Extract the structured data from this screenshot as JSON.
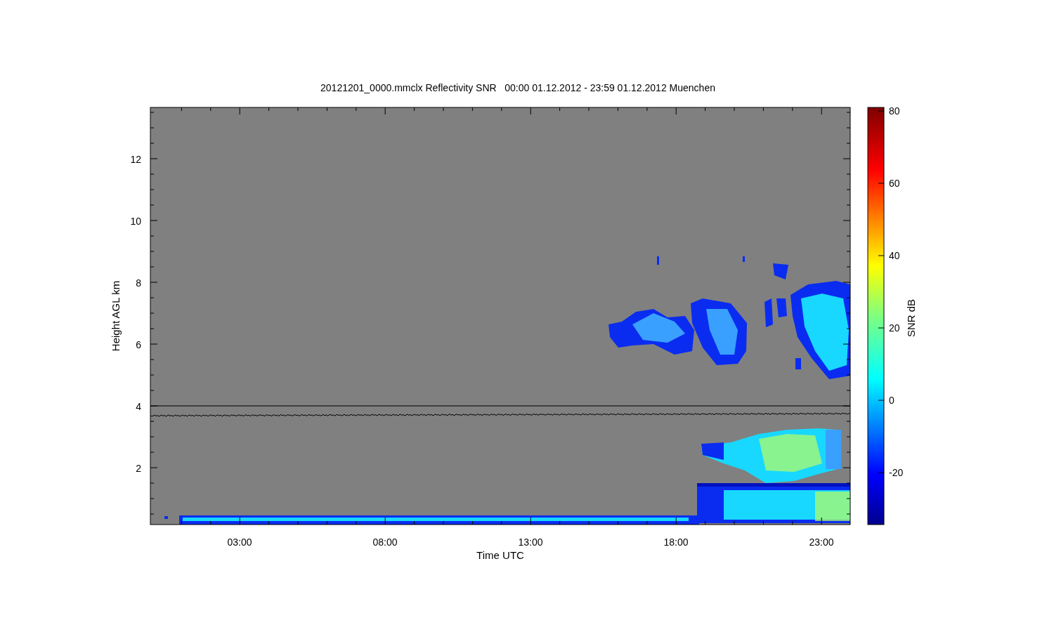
{
  "figure": {
    "title": "20121201_0000.mmclx Reflectivity SNR   00:00 01.12.2012 - 23:59 01.12.2012 Muenchen",
    "x_axis": {
      "label": "Time UTC",
      "ticks": [
        "03:00",
        "08:00",
        "13:00",
        "18:00",
        "23:00"
      ]
    },
    "y_axis": {
      "label": "Height AGL km",
      "ticks": [
        "12",
        "10",
        "8",
        "6",
        "4",
        "2"
      ]
    },
    "colorbar": {
      "label": "SNR dB",
      "ticks": [
        "80",
        "60",
        "40",
        "20",
        "0",
        "-20"
      ]
    }
  }
}
